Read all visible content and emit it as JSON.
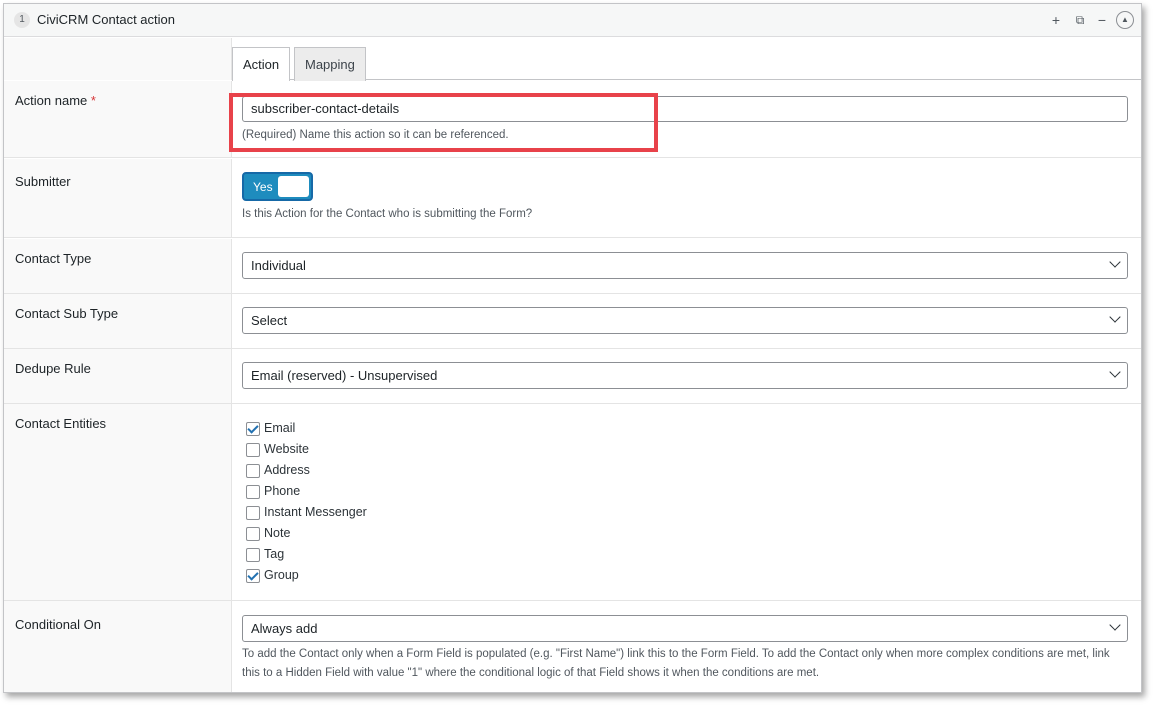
{
  "header": {
    "row_number": "1",
    "title": "CiviCRM Contact action",
    "add_label": "+",
    "duplicate_label": "⧉",
    "remove_label": "−",
    "collapse_label": "▲"
  },
  "tabs": [
    {
      "label": "Action",
      "active": true
    },
    {
      "label": "Mapping",
      "active": false
    }
  ],
  "fields": {
    "action_name": {
      "label": "Action name",
      "required_mark": "*",
      "value": "subscriber-contact-details",
      "description": "(Required) Name this action so it can be referenced."
    },
    "submitter": {
      "label": "Submitter",
      "toggle_label": "Yes",
      "toggle_on": true,
      "description": "Is this Action for the Contact who is submitting the Form?"
    },
    "contact_type": {
      "label": "Contact Type",
      "selected": "Individual"
    },
    "contact_sub_type": {
      "label": "Contact Sub Type",
      "selected": "Select"
    },
    "dedupe_rule": {
      "label": "Dedupe Rule",
      "selected": "Email (reserved) - Unsupervised"
    },
    "contact_entities": {
      "label": "Contact Entities",
      "options": [
        {
          "label": "Email",
          "checked": true
        },
        {
          "label": "Website",
          "checked": false
        },
        {
          "label": "Address",
          "checked": false
        },
        {
          "label": "Phone",
          "checked": false
        },
        {
          "label": "Instant Messenger",
          "checked": false
        },
        {
          "label": "Note",
          "checked": false
        },
        {
          "label": "Tag",
          "checked": false
        },
        {
          "label": "Group",
          "checked": true
        }
      ]
    },
    "conditional_on": {
      "label": "Conditional On",
      "selected": "Always add",
      "description_line1": "To add the Contact only when a Form Field is populated (e.g. \"First Name\") link this to the Form Field. To add the Contact only when more complex conditions are met, link",
      "description_line2": "this to a Hidden Field with value \"1\" where the conditional logic of that Field shows it when the conditions are met."
    }
  },
  "colors": {
    "highlight": "#e8424a",
    "toggle_on": "#1e8cbe",
    "checkbox_check": "#2271b1"
  }
}
